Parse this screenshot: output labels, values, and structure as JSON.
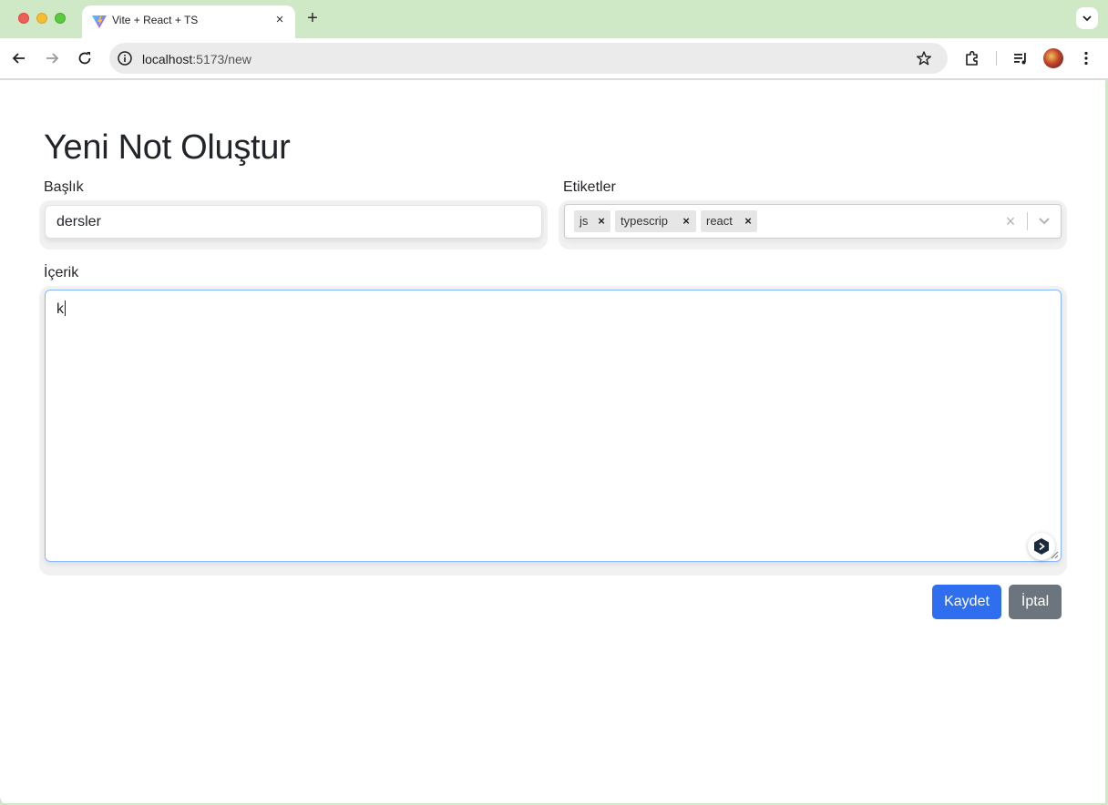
{
  "browser": {
    "tab_title": "Vite + React + TS",
    "tab_close": "×",
    "new_tab": "+",
    "url_host": "localhost",
    "url_path": ":5173/new"
  },
  "page": {
    "title": "Yeni Not Oluştur",
    "title_label": "Başlık",
    "title_value": "dersler",
    "tags_label": "Etiketler",
    "tags": [
      "js",
      "typescrip",
      "react"
    ],
    "tag_remove": "×",
    "tags_clear": "×",
    "body_label": "İçerik",
    "body_value": "k",
    "save_label": "Kaydet",
    "cancel_label": "İptal"
  },
  "colors": {
    "primary": "#2f6fef",
    "secondary": "#6c757d",
    "focus_border": "#86b7fe",
    "chrome_bg": "#cfe9c6"
  }
}
